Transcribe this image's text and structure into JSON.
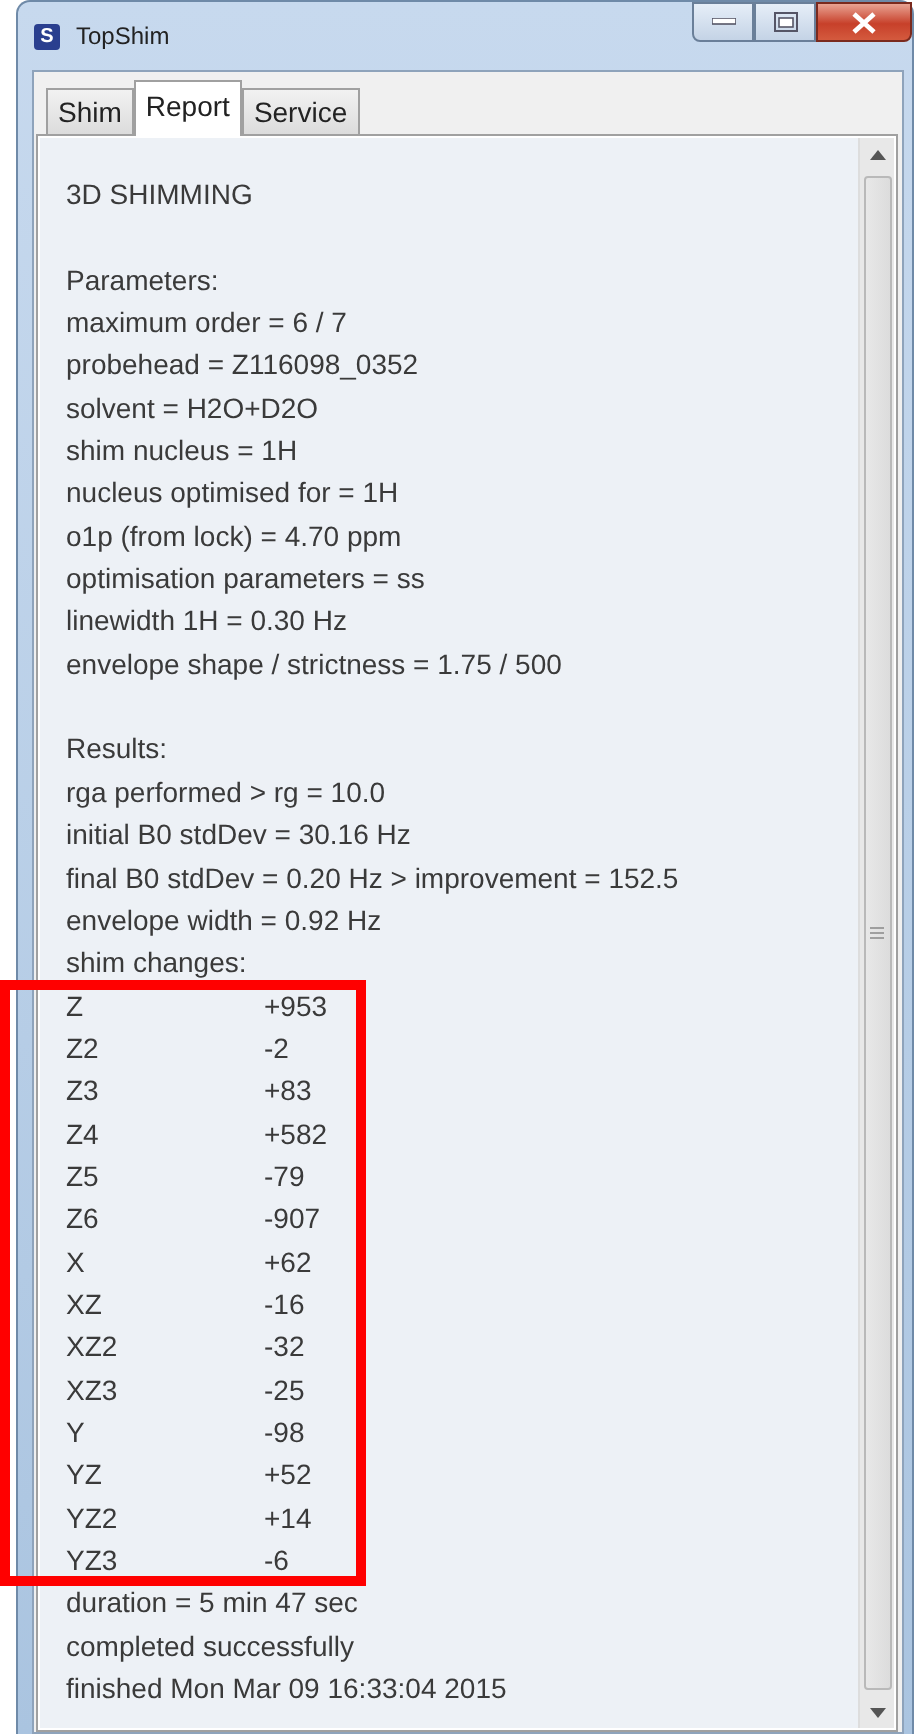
{
  "window": {
    "icon_letter": "S",
    "title": "TopShim"
  },
  "tabs": [
    {
      "label": "Shim",
      "selected": false
    },
    {
      "label": "Report",
      "selected": true
    },
    {
      "label": "Service",
      "selected": false
    }
  ],
  "report": {
    "title": "3D SHIMMING",
    "parameters": {
      "heading": "Parameters:",
      "lines": [
        "maximum order = 6 / 7",
        "probehead = Z116098_0352",
        "solvent = H2O+D2O",
        "shim nucleus = 1H",
        "nucleus optimised for = 1H",
        "o1p (from lock) = 4.70 ppm",
        "optimisation parameters = ss",
        "linewidth 1H = 0.30 Hz",
        "envelope shape / strictness = 1.75 / 500"
      ]
    },
    "results": {
      "heading": "Results:",
      "lines": [
        "rga performed > rg = 10.0",
        "initial B0 stdDev = 30.16 Hz",
        "final B0 stdDev = 0.20 Hz > improvement = 152.5",
        "envelope width = 0.92 Hz",
        "shim changes:"
      ]
    },
    "shim_changes": {
      "highlighted": true,
      "rows": [
        {
          "name": "Z",
          "value": "+953"
        },
        {
          "name": "Z2",
          "value": "-2"
        },
        {
          "name": "Z3",
          "value": "+83"
        },
        {
          "name": "Z4",
          "value": "+582"
        },
        {
          "name": "Z5",
          "value": "-79"
        },
        {
          "name": "Z6",
          "value": "-907"
        },
        {
          "name": "X",
          "value": "+62"
        },
        {
          "name": "XZ",
          "value": "-16"
        },
        {
          "name": "XZ2",
          "value": "-32"
        },
        {
          "name": "XZ3",
          "value": "-25"
        },
        {
          "name": "Y",
          "value": "-98"
        },
        {
          "name": "YZ",
          "value": "+52"
        },
        {
          "name": "YZ2",
          "value": "+14"
        },
        {
          "name": "YZ3",
          "value": "-6"
        }
      ]
    },
    "footer_lines": [
      "duration = 5 min 47 sec",
      "completed successfully",
      "finished Mon Mar 09 16:33:04 2015"
    ]
  }
}
